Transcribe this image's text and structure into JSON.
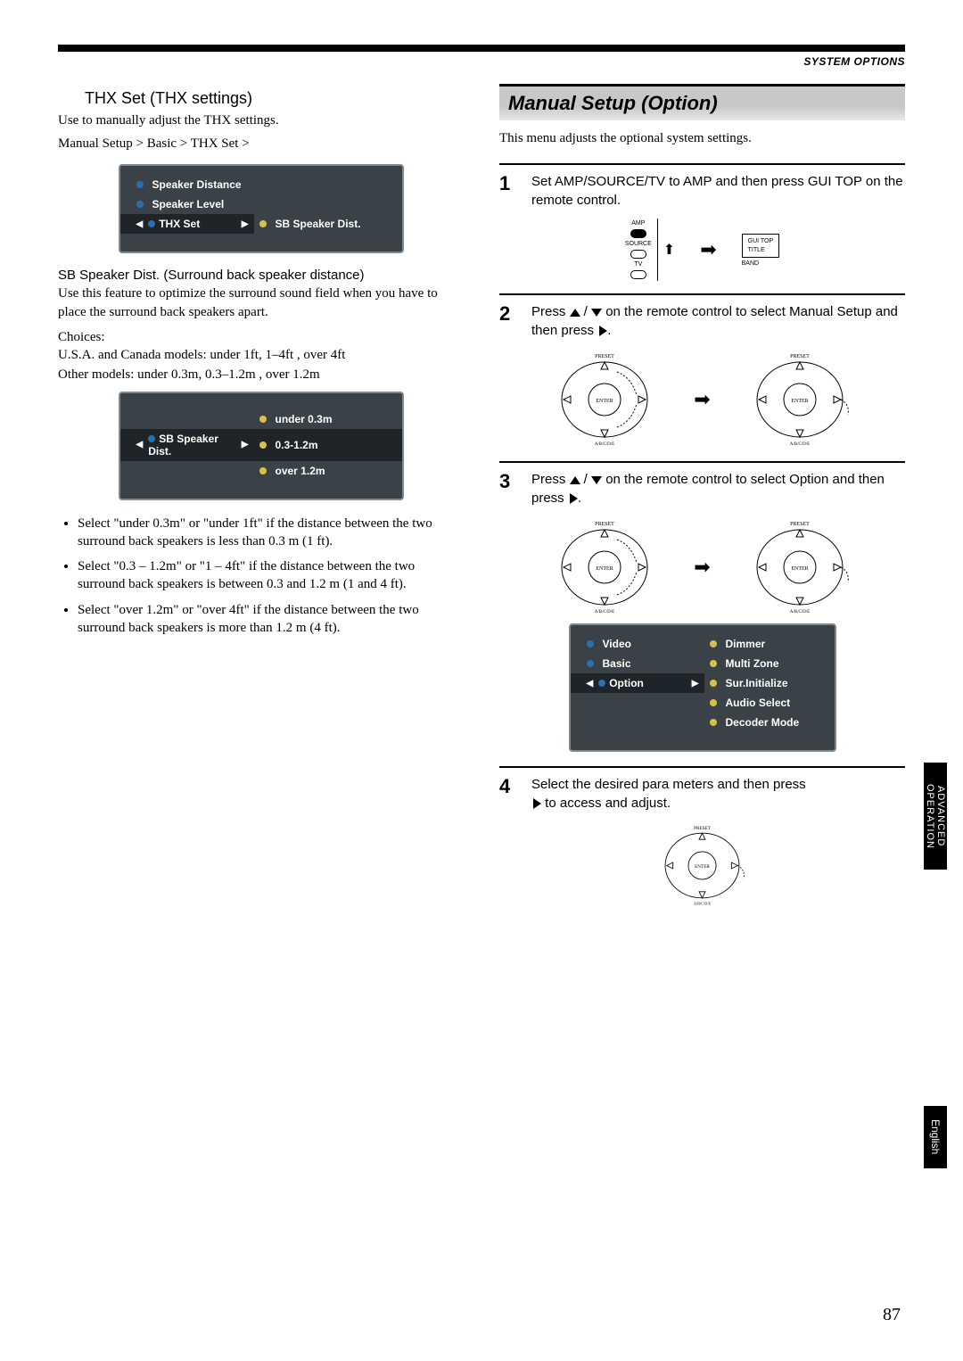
{
  "headerRight": "SYSTEM OPTIONS",
  "left": {
    "thxTitle": "THX Set (THX settings)",
    "thxDesc": "Use to manually adjust the THX settings.",
    "thxPath": "Manual Setup > Basic > THX Set >",
    "screen1": {
      "l0": "Speaker Distance",
      "l1": "Speaker Level",
      "l2": "THX Set",
      "r0": "SB Speaker Dist."
    },
    "sbTitle": "SB Speaker Dist. (Surround back speaker distance)",
    "sbDesc": "Use this feature to optimize the surround sound field when you have to place the surround back speakers apart.",
    "choicesLabel": "Choices:",
    "choiceUS": "U.S.A. and Canada models: under 1ft, 1–4ft , over 4ft",
    "choiceOther": "Other models: under 0.3m, 0.3–1.2m , over 1.2m",
    "screen2": {
      "left": "SB Speaker Dist.",
      "r0": "under 0.3m",
      "r1": "0.3-1.2m",
      "r2": "over 1.2m"
    },
    "b1": "Select \"under 0.3m\" or \"under 1ft\" if the distance between the two surround back speakers is less than 0.3 m (1 ft).",
    "b2": "Select \"0.3 – 1.2m\" or \"1 – 4ft\" if the distance between the two surround back speakers is between 0.3 and 1.2 m (1 and 4 ft).",
    "b3": "Select \"over 1.2m\" or \"over 4ft\" if the distance between the two surround back speakers is more than 1.2 m (4 ft)."
  },
  "right": {
    "mainHead": "Manual Setup (Option)",
    "intro": "This menu adjusts the optional system settings.",
    "step1": "Set AMP/SOURCE/TV to AMP and then press GUI TOP on the remote control.",
    "step2a": "Press ",
    "step2b": " on the remote control to select Manual Setup and then press ",
    "step3a": "Press ",
    "step3b": " on the remote control to select Option and then press ",
    "step4a": "Select the desired para meters and then press ",
    "step4b": " to access and adjust.",
    "ampLabels": {
      "amp": "AMP",
      "source": "SOURCE",
      "tv": "TV",
      "gui": "GUI TOP",
      "title": "TITLE",
      "band": "BAND"
    },
    "padLabels": {
      "preset": "PRESET",
      "enter": "ENTER",
      "abcde": "A/B/C/D/E"
    },
    "screen3": {
      "l0": "Video",
      "l1": "Basic",
      "l2": "Option",
      "r0": "Dimmer",
      "r1": "Multi Zone",
      "r2": "Sur.Initialize",
      "r3": "Audio Select",
      "r4": "Decoder Mode"
    }
  },
  "sideTab1": "ADVANCED\nOPERATION",
  "sideTab2": "English",
  "pageNum": "87"
}
